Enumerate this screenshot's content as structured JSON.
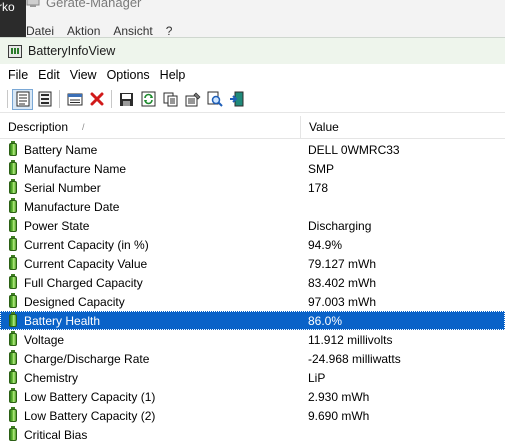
{
  "background_window": {
    "left_text": "rko",
    "title": "Geräte-Manager",
    "menu": [
      "Datei",
      "Aktion",
      "Ansicht",
      "?"
    ]
  },
  "window": {
    "title": "BatteryInfoView"
  },
  "menu": [
    "File",
    "Edit",
    "View",
    "Options",
    "Help"
  ],
  "toolbar": {
    "icons": [
      "html-report-icon",
      "text-report-icon",
      "properties-window-icon",
      "delete-icon",
      "save-icon",
      "refresh-icon",
      "copy-icon",
      "properties-icon",
      "find-icon",
      "exit-icon"
    ]
  },
  "columns": {
    "description": "Description",
    "value": "Value",
    "sort_indicator": "/"
  },
  "rows": [
    {
      "description": "Battery Name",
      "value": "DELL 0WMRC33"
    },
    {
      "description": "Manufacture Name",
      "value": "SMP"
    },
    {
      "description": "Serial Number",
      "value": "178"
    },
    {
      "description": "Manufacture Date",
      "value": ""
    },
    {
      "description": "Power State",
      "value": "Discharging"
    },
    {
      "description": "Current Capacity (in %)",
      "value": "94.9%"
    },
    {
      "description": "Current Capacity Value",
      "value": "79.127 mWh"
    },
    {
      "description": "Full Charged Capacity",
      "value": "83.402 mWh"
    },
    {
      "description": "Designed Capacity",
      "value": "97.003 mWh"
    },
    {
      "description": "Battery Health",
      "value": "86.0%",
      "selected": true
    },
    {
      "description": "Voltage",
      "value": "11.912 millivolts"
    },
    {
      "description": "Charge/Discharge Rate",
      "value": "-24.968 milliwatts"
    },
    {
      "description": "Chemistry",
      "value": "LiP"
    },
    {
      "description": "Low Battery Capacity (1)",
      "value": "2.930 mWh"
    },
    {
      "description": "Low Battery Capacity (2)",
      "value": "9.690 mWh"
    },
    {
      "description": "Critical Bias",
      "value": ""
    }
  ],
  "colors": {
    "selection": "#0a62c8",
    "titlebar": "#eef5ec"
  }
}
